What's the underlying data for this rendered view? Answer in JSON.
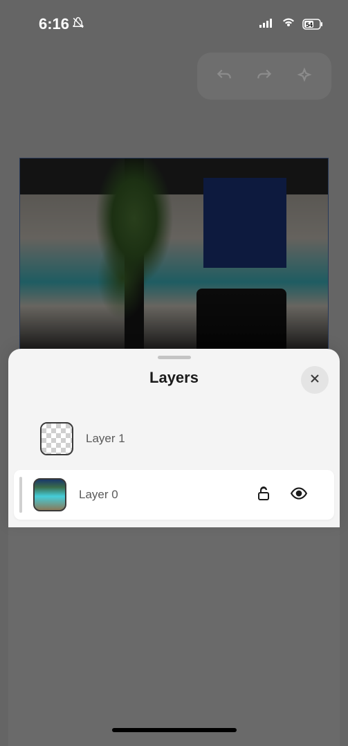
{
  "statusBar": {
    "time": "6:16",
    "battery": "54"
  },
  "panel": {
    "title": "Layers"
  },
  "layers": [
    {
      "name": "Layer 1",
      "selected": false,
      "locked": false,
      "visible": true
    },
    {
      "name": "Layer 0",
      "selected": true,
      "locked": false,
      "visible": true
    }
  ]
}
